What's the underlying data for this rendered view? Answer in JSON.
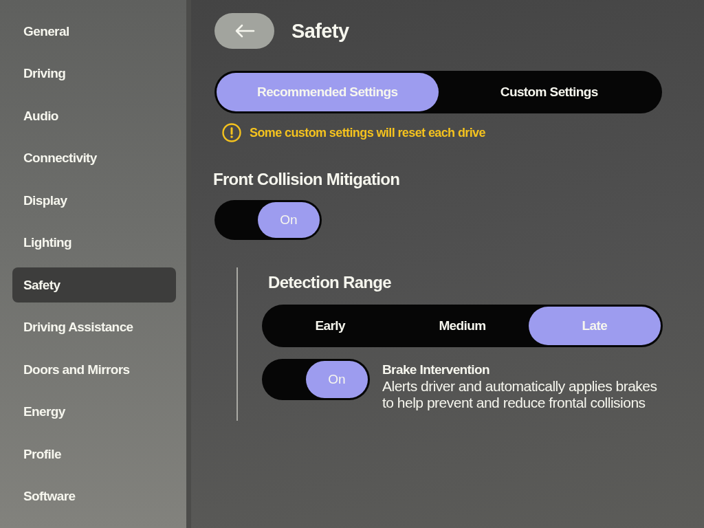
{
  "sidebar": {
    "items": [
      {
        "label": "General",
        "selected": false
      },
      {
        "label": "Driving",
        "selected": false
      },
      {
        "label": "Audio",
        "selected": false
      },
      {
        "label": "Connectivity",
        "selected": false
      },
      {
        "label": "Display",
        "selected": false
      },
      {
        "label": "Lighting",
        "selected": false
      },
      {
        "label": "Safety",
        "selected": true
      },
      {
        "label": "Driving Assistance",
        "selected": false
      },
      {
        "label": "Doors and Mirrors",
        "selected": false
      },
      {
        "label": "Energy",
        "selected": false
      },
      {
        "label": "Profile",
        "selected": false
      },
      {
        "label": "Software",
        "selected": false
      }
    ]
  },
  "header": {
    "title": "Safety"
  },
  "mode_selector": {
    "options": [
      {
        "label": "Recommended Settings",
        "selected": true
      },
      {
        "label": "Custom Settings",
        "selected": false
      }
    ]
  },
  "warning": {
    "text": "Some custom settings will reset each drive"
  },
  "front_collision_mitigation": {
    "title": "Front Collision Mitigation",
    "toggle": {
      "label": "On",
      "on": true
    },
    "detection_range": {
      "title": "Detection Range",
      "options": [
        {
          "label": "Early",
          "selected": false
        },
        {
          "label": "Medium",
          "selected": false
        },
        {
          "label": "Late",
          "selected": true
        }
      ]
    },
    "brake_intervention": {
      "title": "Brake Intervention",
      "description": "Alerts driver and automatically applies brakes to help prevent and reduce frontal collisions",
      "toggle": {
        "label": "On",
        "on": true
      }
    }
  }
}
